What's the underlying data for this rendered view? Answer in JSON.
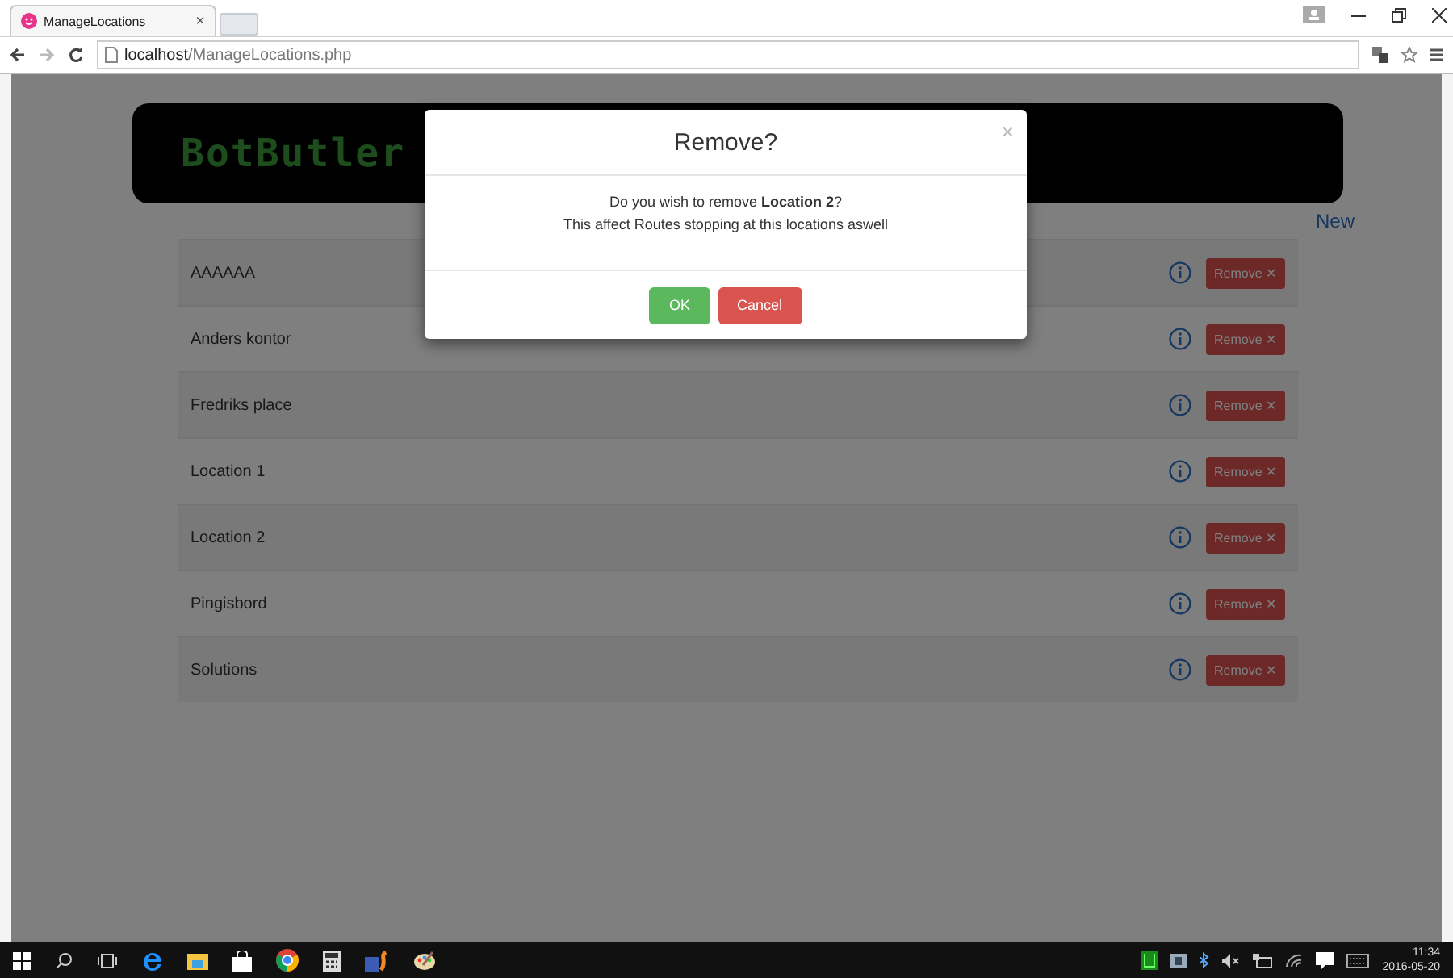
{
  "browser": {
    "tab_title": "ManageLocations",
    "tab_close": "×",
    "url_host": "localhost",
    "url_path": "/ManageLocations.php"
  },
  "header": {
    "logo": "BotButler"
  },
  "new_link": "New",
  "locations": [
    {
      "name": "AAAAAA",
      "remove": "Remove ✕"
    },
    {
      "name": "Anders kontor",
      "remove": "Remove ✕"
    },
    {
      "name": "Fredriks place",
      "remove": "Remove ✕"
    },
    {
      "name": "Location 1",
      "remove": "Remove ✕"
    },
    {
      "name": "Location 2",
      "remove": "Remove ✕"
    },
    {
      "name": "Pingisbord",
      "remove": "Remove ✕"
    },
    {
      "name": "Solutions",
      "remove": "Remove ✕"
    }
  ],
  "dialog": {
    "title": "Remove?",
    "close": "×",
    "message": "Do you wish to remove **Location 2**?",
    "note": "This affect Routes stopping at this locations aswell",
    "ok": "OK",
    "cancel": "Cancel"
  },
  "taskbar": {
    "time": "11:34",
    "date": "2016-05-20"
  }
}
